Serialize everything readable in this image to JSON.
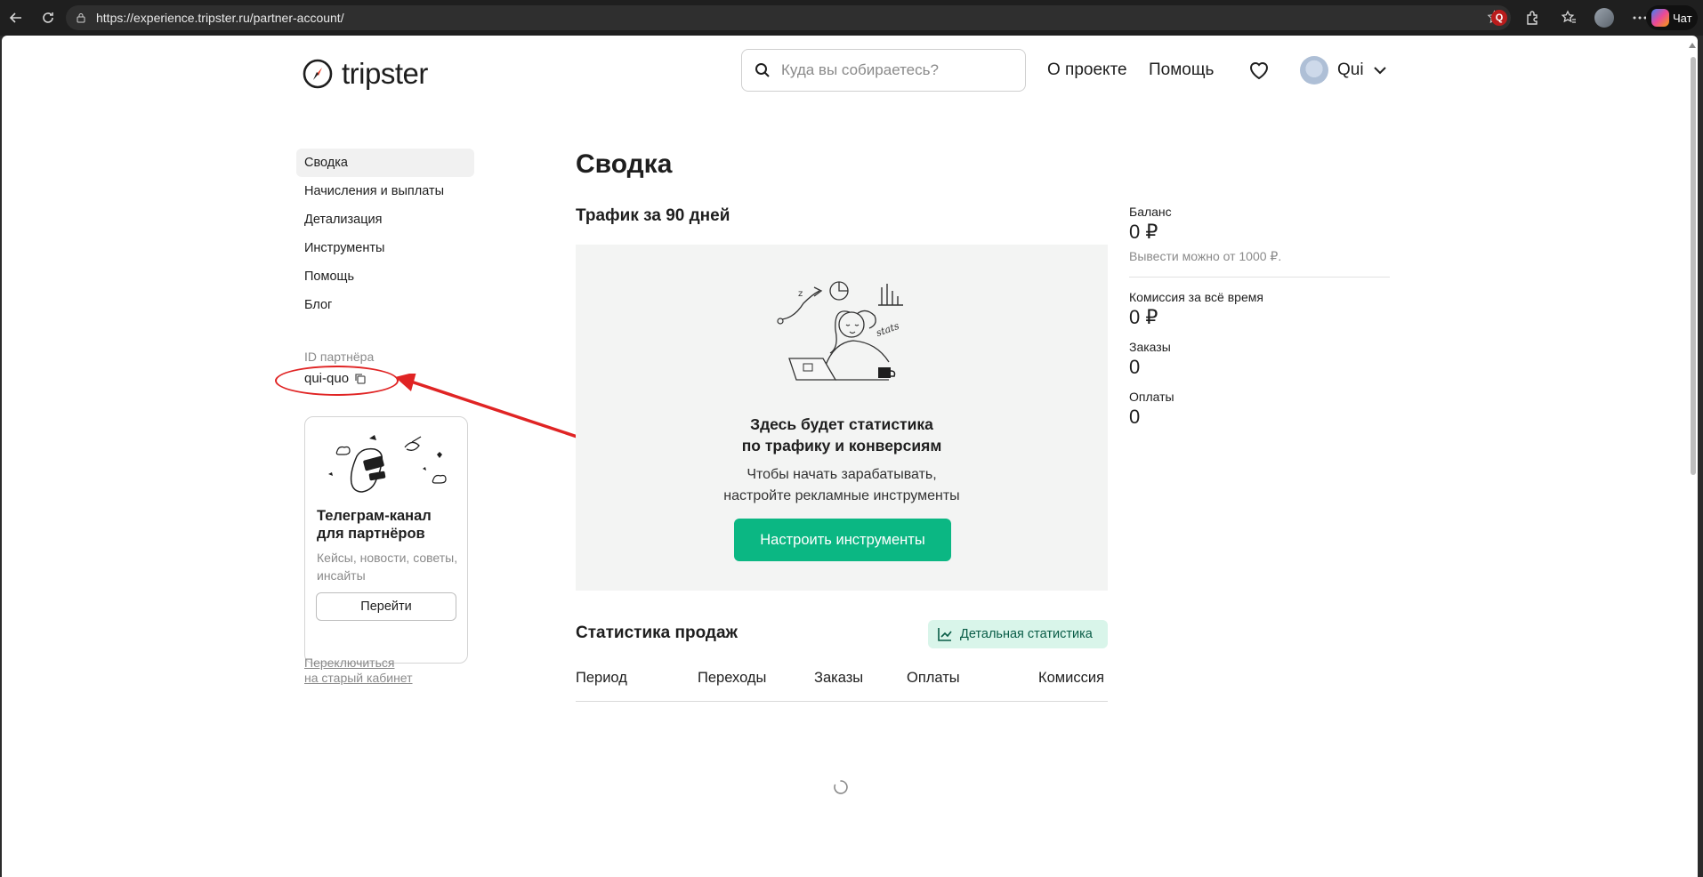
{
  "browser": {
    "url": "https://experience.tripster.ru/partner-account/",
    "chat_label": "Чат",
    "ext_label": "Q"
  },
  "header": {
    "logo_text": "tripster",
    "search_placeholder": "Куда вы собираетесь?",
    "nav": [
      "О проекте",
      "Помощь"
    ],
    "user_name": "Qui"
  },
  "sidebar": {
    "items": [
      {
        "label": "Сводка",
        "active": true
      },
      {
        "label": "Начисления и выплаты"
      },
      {
        "label": "Детализация"
      },
      {
        "label": "Инструменты"
      },
      {
        "label": "Помощь"
      },
      {
        "label": "Блог"
      }
    ],
    "partner_id_label": "ID партнёра",
    "partner_id": "qui-quo",
    "telegram": {
      "title": "Телеграм-канал для партнёров",
      "desc": "Кейсы, новости, советы, инсайты",
      "button": "Перейти"
    },
    "old_cabinet_line1": "Переключиться",
    "old_cabinet_line2": "на старый кабинет"
  },
  "main": {
    "title": "Сводка",
    "traffic_title": "Трафик за 90 дней",
    "illus_text": "stats",
    "empty_title_line1": "Здесь будет статистика",
    "empty_title_line2": "по трафику и конверсиям",
    "empty_desc_line1": "Чтобы начать зарабатывать,",
    "empty_desc_line2": "настройте рекламные инструменты",
    "setup_button": "Настроить инструменты",
    "sales_title": "Статистика продаж",
    "detail_button": "Детальная статистика",
    "table_headers": [
      "Период",
      "Переходы",
      "Заказы",
      "Оплаты",
      "Комиссия"
    ]
  },
  "summary": {
    "balance_label": "Баланс",
    "balance_value": "0 ₽",
    "balance_note": "Вывести можно от 1000 ₽.",
    "commission_label": "Комиссия за всё время",
    "commission_value": "0 ₽",
    "orders_label": "Заказы",
    "orders_value": "0",
    "payments_label": "Оплаты",
    "payments_value": "0"
  },
  "colors": {
    "accent": "#0bb783",
    "annotation": "#e02424"
  }
}
